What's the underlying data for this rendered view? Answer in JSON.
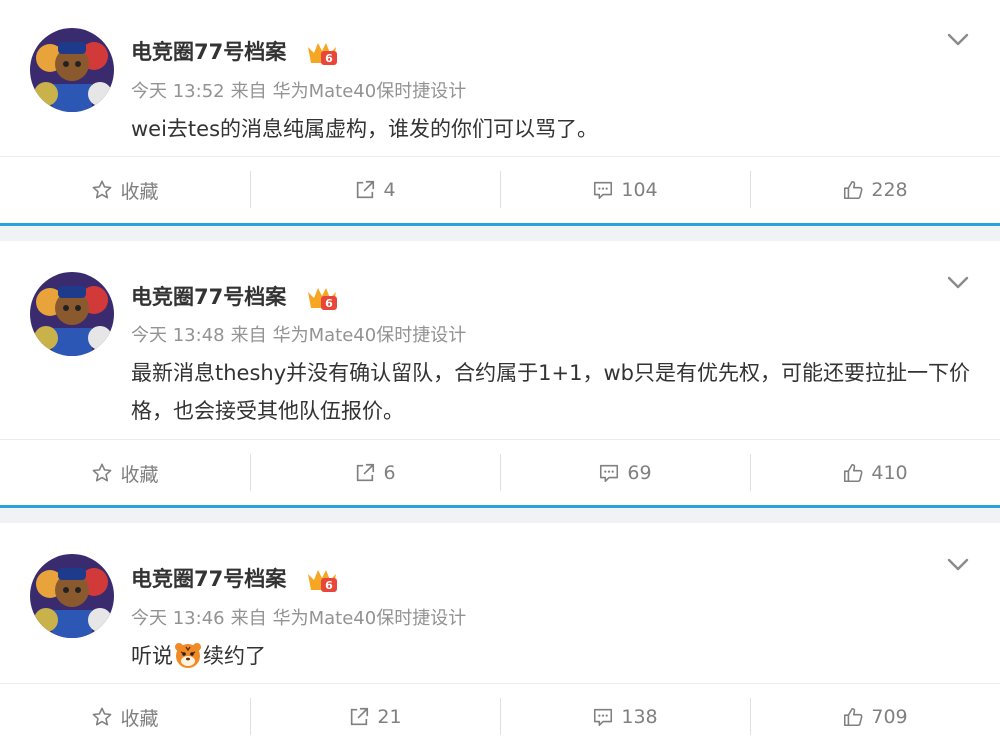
{
  "posts": [
    {
      "author": "电竞圈77号档案",
      "time": "今天 13:52",
      "source_prefix": "来自",
      "source": "华为Mate40保时捷设计",
      "text": "wei去tes的消息纯属虚构，谁发的你们可以骂了。",
      "actions": {
        "favorite": "收藏",
        "repost": "4",
        "comment": "104",
        "like": "228"
      }
    },
    {
      "author": "电竞圈77号档案",
      "time": "今天 13:48",
      "source_prefix": "来自",
      "source": "华为Mate40保时捷设计",
      "text": "最新消息theshy并没有确认留队，合约属于1+1，wb只是有优先权，可能还要拉扯一下价格，也会接受其他队伍报价。",
      "actions": {
        "favorite": "收藏",
        "repost": "6",
        "comment": "69",
        "like": "410"
      }
    },
    {
      "author": "电竞圈77号档案",
      "time": "今天 13:46",
      "source_prefix": "来自",
      "source": "华为Mate40保时捷设计",
      "text_before": "听说",
      "text_emoji": "tiger-emoji",
      "text_after": "续约了",
      "actions": {
        "favorite": "收藏",
        "repost": "21",
        "comment": "138",
        "like": "709"
      }
    }
  ],
  "colors": {
    "separator_line": "#27a3d9",
    "separator_bg": "#f1f2f5",
    "meta_text": "#939393",
    "action_text": "#808080",
    "badge_gold": "#f5a623",
    "badge_red": "#e8463a"
  },
  "icons": {
    "favorite": "star-icon",
    "repost": "share-arrow-icon",
    "comment": "comment-bubble-icon",
    "like": "thumbs-up-icon",
    "menu": "chevron-down-icon",
    "badge": "crown-badge-icon"
  }
}
